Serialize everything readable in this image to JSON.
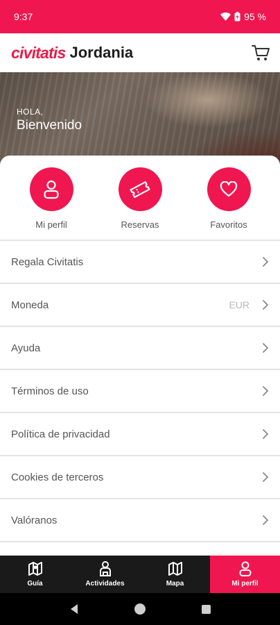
{
  "status": {
    "time": "9:37",
    "battery": "95 %"
  },
  "header": {
    "brand": "civitatis",
    "destination": "Jordania",
    "cart_icon": "cart-icon"
  },
  "hero": {
    "greeting": "HOLA,",
    "welcome": "Bienvenido"
  },
  "quick_actions": [
    {
      "label": "Mi perfil",
      "icon": "user-icon"
    },
    {
      "label": "Reservas",
      "icon": "ticket-icon"
    },
    {
      "label": "Favoritos",
      "icon": "heart-icon"
    }
  ],
  "menu": [
    {
      "label": "Regala Civitatis",
      "value": ""
    },
    {
      "label": "Moneda",
      "value": "EUR"
    },
    {
      "label": "Ayuda",
      "value": ""
    },
    {
      "label": "Términos de uso",
      "value": ""
    },
    {
      "label": "Política de privacidad",
      "value": ""
    },
    {
      "label": "Cookies de terceros",
      "value": ""
    },
    {
      "label": "Valóranos",
      "value": ""
    }
  ],
  "bottom_nav": [
    {
      "label": "Guía",
      "icon": "guide-map-icon",
      "active": false
    },
    {
      "label": "Actividades",
      "icon": "activities-icon",
      "active": false
    },
    {
      "label": "Mapa",
      "icon": "map-icon",
      "active": false
    },
    {
      "label": "Mi perfil",
      "icon": "profile-icon",
      "active": true
    }
  ],
  "colors": {
    "accent": "#f0164f",
    "nav_bg": "#1a1a1a"
  }
}
